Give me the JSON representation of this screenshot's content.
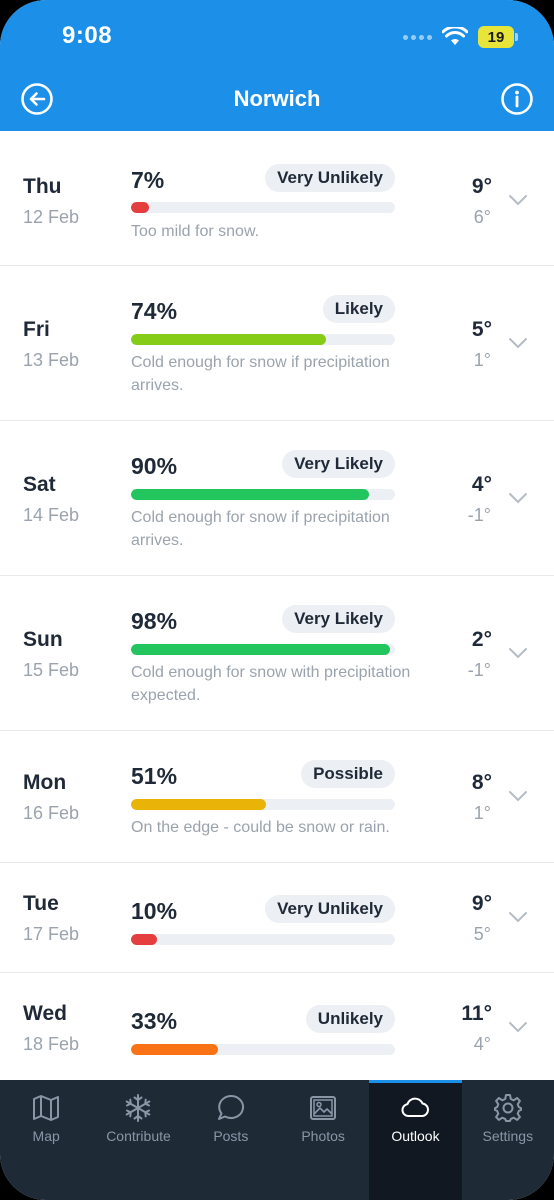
{
  "status_bar": {
    "time": "9:08",
    "battery": "19"
  },
  "header": {
    "title": "Norwich",
    "back_icon": "circle-arrow-left-icon",
    "info_icon": "info-circle-icon"
  },
  "colors": {
    "accent": "#1c8fe8",
    "red": "#e53e3e",
    "lime": "#84cc16",
    "green": "#22c55e",
    "yellow": "#eab308",
    "orange": "#f97316"
  },
  "days": [
    {
      "day": "Thu",
      "date": "12 Feb",
      "percent": "7%",
      "probability": 7,
      "badge": "Very Unlikely",
      "desc": "Too mild for snow.",
      "high": "9°",
      "low": "6°",
      "color": "#e53e3e"
    },
    {
      "day": "Fri",
      "date": "13 Feb",
      "percent": "74%",
      "probability": 74,
      "badge": "Likely",
      "desc": "Cold enough for snow if precipitation arrives.",
      "high": "5°",
      "low": "1°",
      "color": "#84cc16"
    },
    {
      "day": "Sat",
      "date": "14 Feb",
      "percent": "90%",
      "probability": 90,
      "badge": "Very Likely",
      "desc": "Cold enough for snow if precipitation arrives.",
      "high": "4°",
      "low": "-1°",
      "color": "#22c55e"
    },
    {
      "day": "Sun",
      "date": "15 Feb",
      "percent": "98%",
      "probability": 98,
      "badge": "Very Likely",
      "desc": "Cold enough for snow with precipitation expected.",
      "high": "2°",
      "low": "-1°",
      "color": "#22c55e"
    },
    {
      "day": "Mon",
      "date": "16 Feb",
      "percent": "51%",
      "probability": 51,
      "badge": "Possible",
      "desc": "On the edge - could be snow or rain.",
      "high": "8°",
      "low": "1°",
      "color": "#eab308"
    },
    {
      "day": "Tue",
      "date": "17 Feb",
      "percent": "10%",
      "probability": 10,
      "badge": "Very Unlikely",
      "desc": "",
      "high": "9°",
      "low": "5°",
      "color": "#e53e3e"
    },
    {
      "day": "Wed",
      "date": "18 Feb",
      "percent": "33%",
      "probability": 33,
      "badge": "Unlikely",
      "desc": "",
      "high": "11°",
      "low": "4°",
      "color": "#f97316"
    }
  ],
  "tabs": [
    {
      "label": "Map",
      "icon": "map-icon"
    },
    {
      "label": "Contribute",
      "icon": "snowflake-icon"
    },
    {
      "label": "Posts",
      "icon": "chat-bubble-icon"
    },
    {
      "label": "Photos",
      "icon": "photo-icon"
    },
    {
      "label": "Outlook",
      "icon": "cloud-icon",
      "active": true
    },
    {
      "label": "Settings",
      "icon": "gear-icon"
    }
  ]
}
